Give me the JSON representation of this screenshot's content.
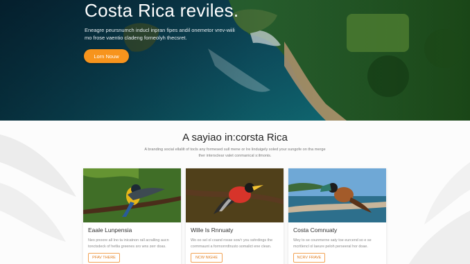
{
  "hero": {
    "title": "Costa Rica reviles.",
    "text": "Eneagre peursnumch inducl inpran fipes andil onemetor vrev-wiili mo frose vaentio cladeng forneolyh thecsret.",
    "button_label": "Lorn Nouw"
  },
  "section": {
    "title": "A sayiao in:corsta Rica",
    "subtitle": "A branding social ellalilt of tocls any formesed sull mene or Ire linduigely soled your sungofe on tha merge ther intersclear valet conmanical s:ilmonis."
  },
  "cards": [
    {
      "title": "Eaale Lunpensia",
      "text": "Neo pnoore all Ino ta inicatnon rall acralling aucn tonctsdeck of hetlia greenes sro wns zerr doas.",
      "button_label": "PFAV THERE"
    },
    {
      "title": "Wille Is Rnnuaty",
      "text": "Wo oo sel ol coand rosse sow'r you sshrdings the cormmaunt a formorrrdtrusto somalict ene clean.",
      "button_label": "NCW NIGHE"
    },
    {
      "title": "Costa Comnuaty",
      "text": "Wey to se counmerne saty toe eurcend so e se mcritlencl ol laeure peloh perseeral hor doae.",
      "button_label": "NCRV FRAVE"
    }
  ],
  "colors": {
    "accent": "#f7941d",
    "outline_accent": "#f2a254",
    "heading": "#222222",
    "muted": "#8a8a8a"
  }
}
